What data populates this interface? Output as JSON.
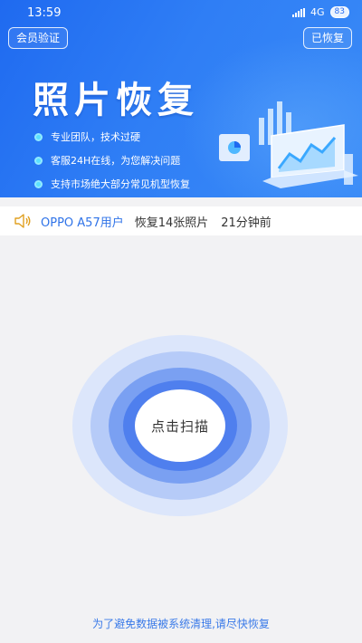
{
  "status_bar": {
    "time": "13:59",
    "network": "4G",
    "battery": "83"
  },
  "header": {
    "member_button": "会员验证",
    "recovered_button": "已恢复",
    "title": "照片恢复",
    "features": [
      "专业团队，技术过硬",
      "客服24H在线，为您解决问题",
      "支持市场绝大部分常见机型恢复"
    ]
  },
  "notice": {
    "user": "OPPO A57用户",
    "action": "恢复14张照片",
    "time": "21分钟前"
  },
  "scan": {
    "button_label": "点击扫描"
  },
  "footer": {
    "hint": "为了避免数据被系统清理,请尽快恢复"
  },
  "colors": {
    "accent": "#2f73e8",
    "hero_gradient_start": "#1f6af0",
    "hero_gradient_end": "#3a8bf7",
    "ring_dark": "#4f7fee",
    "ring_light": "#dce6fb",
    "feature_dot": "#5ae0ff"
  },
  "icons": [
    "signal-icon",
    "battery-icon",
    "speaker-icon",
    "laptop-illustration"
  ]
}
